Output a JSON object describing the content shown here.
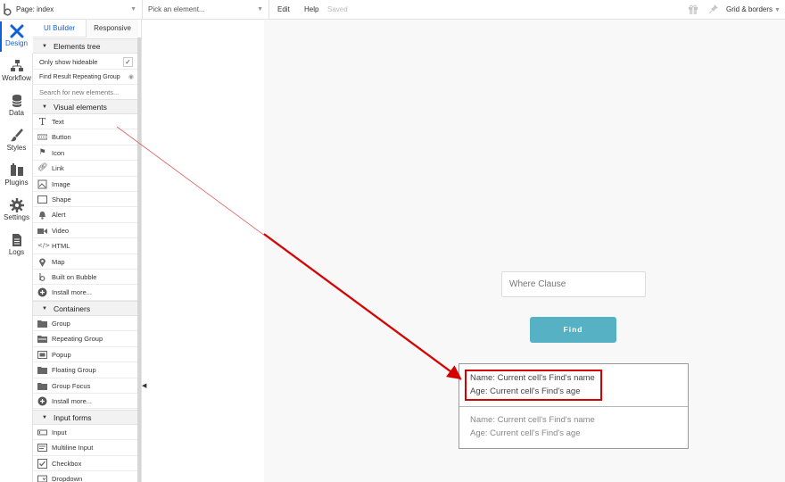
{
  "topbar": {
    "page_label": "Page: index",
    "pick_placeholder": "Pick an element...",
    "menu_edit": "Edit",
    "menu_help": "Help",
    "saved_status": "Saved",
    "grid_label": "Grid & borders"
  },
  "leftnav": [
    {
      "label": "Design",
      "icon": "design-icon",
      "active": true
    },
    {
      "label": "Workflow",
      "icon": "workflow-icon"
    },
    {
      "label": "Data",
      "icon": "database-icon"
    },
    {
      "label": "Styles",
      "icon": "brush-icon"
    },
    {
      "label": "Plugins",
      "icon": "plug-icon"
    },
    {
      "label": "Settings",
      "icon": "gear-icon"
    },
    {
      "label": "Logs",
      "icon": "document-icon"
    }
  ],
  "panel": {
    "tab_ui": "UI Builder",
    "tab_responsive": "Responsive",
    "elements_tree": "Elements tree",
    "only_hideable": "Only show hideable",
    "find_result": "Find Result Repeating Group",
    "search_placeholder": "Search for new elements...",
    "visual_header": "Visual elements",
    "visual_items": [
      "Text",
      "Button",
      "Icon",
      "Link",
      "Image",
      "Shape",
      "Alert",
      "Video",
      "HTML",
      "Map",
      "Built on Bubble",
      "Install more..."
    ],
    "containers_header": "Containers",
    "container_items": [
      "Group",
      "Repeating Group",
      "Popup",
      "Floating Group",
      "Group Focus",
      "Install more..."
    ],
    "inputs_header": "Input forms",
    "input_items": [
      "Input",
      "Multiline Input",
      "Checkbox",
      "Dropdown"
    ]
  },
  "canvas": {
    "where_placeholder": "Where Clause",
    "find_button": "Find",
    "cell1": {
      "name": "Name: Current cell's Find's name",
      "age": "Age: Current cell's Find's age"
    },
    "cell2": {
      "name": "Name: Current cell's Find's name",
      "age": "Age: Current cell's Find's age"
    }
  },
  "colors": {
    "accent": "#1060d8",
    "find_button": "#55b1c3",
    "highlight": "#d30000"
  }
}
